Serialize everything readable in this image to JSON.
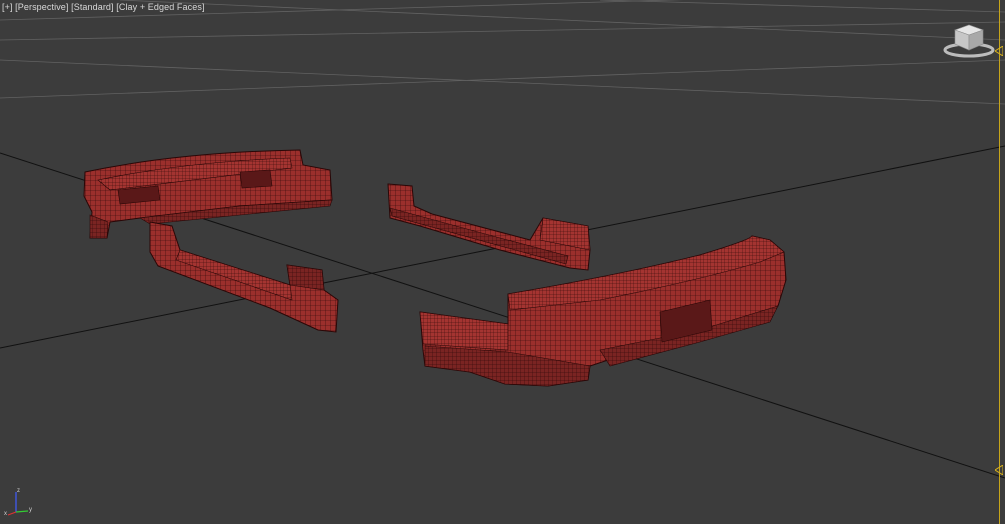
{
  "viewport": {
    "label_parts": [
      "[+]",
      "[Perspective]",
      "[Standard]",
      "[Clay + Edged Faces]"
    ],
    "background": "#3c3c3c",
    "grid_color": "#6a6a6a",
    "axis_line_color": "#111111",
    "border_accent": "#c7a51a"
  },
  "viewcube": {
    "face_label": "TOP",
    "icon": "viewcube-icon"
  },
  "axis_tripod": {
    "x": "x",
    "y": "y",
    "z": "z"
  },
  "model": {
    "mesh_color": "#9b2f2c",
    "wire_color": "#2a0707",
    "parts": [
      "front-bumper",
      "left-side-skirt",
      "right-side-skirt",
      "rear-bumper"
    ]
  }
}
